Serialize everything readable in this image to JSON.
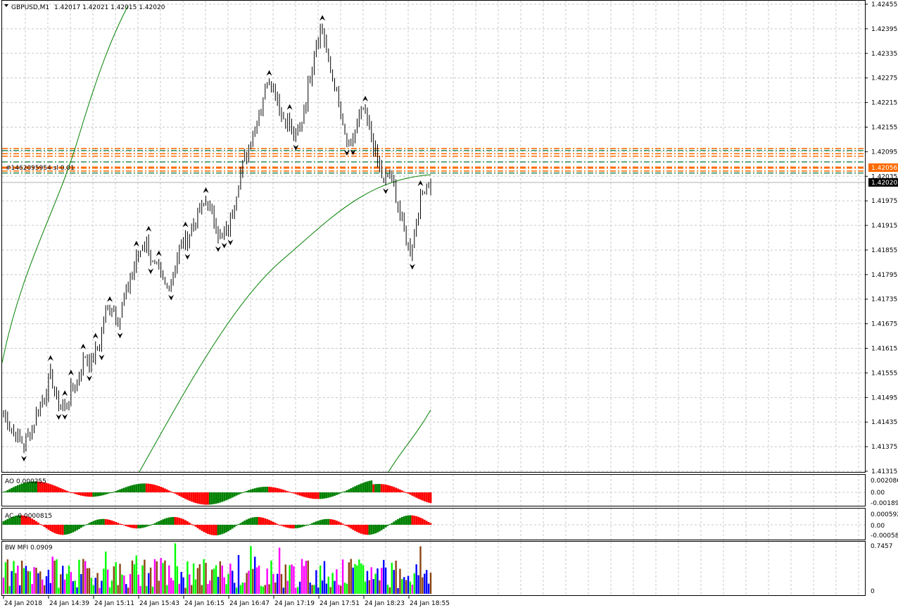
{
  "chart_header": {
    "symbol_tf": "GBPUSD,M1",
    "ohlc": "1.42017 1.42021 1.42015 1.42020",
    "toggle_icon": "triangle-down-icon"
  },
  "colors": {
    "background": "#ffffff",
    "grid": "#c8c8c8",
    "bars": "#000000",
    "ma_line": "#008000",
    "level_orange": "#ff6a00",
    "level_green": "#2e8b57",
    "ao_up": "#008000",
    "ao_down": "#ff0000",
    "mfi_green": "#00ff00",
    "mfi_blue": "#0000ff",
    "mfi_pink": "#ff00ff",
    "mfi_brown": "#8b4513",
    "price_badge_current": "#000000",
    "price_badge_level": "#ff6a00"
  },
  "price_axis": {
    "ticks": [
      "1.42455",
      "1.42395",
      "1.42335",
      "1.42275",
      "1.42215",
      "1.42155",
      "1.42095",
      "1.42035",
      "1.41975",
      "1.41915",
      "1.41855",
      "1.41795",
      "1.41735",
      "1.41675",
      "1.41615",
      "1.41555",
      "1.41495",
      "1.41435",
      "1.41375",
      "1.41315"
    ],
    "current_price": "1.42020",
    "level_price": "1.42056",
    "ylim": [
      1.41315,
      1.42455
    ]
  },
  "level_labels": {
    "main": "#1462095954 sl 0.01"
  },
  "subwindows": {
    "ao": {
      "label": "AO 0.000255",
      "ticks": [
        "0.002086",
        "0.00",
        "-0.001894"
      ]
    },
    "ac": {
      "label": "AC -0.0000815",
      "ticks": [
        "0.000592",
        "0.00",
        "-0.000582"
      ]
    },
    "mfi": {
      "label": "BW MFI 0.0909",
      "ticks": [
        "0.7457",
        "0"
      ]
    }
  },
  "time_axis": {
    "labels": [
      "24 Jan 2018",
      "24 Jan 14:39",
      "24 Jan 15:11",
      "24 Jan 15:43",
      "24 Jan 16:15",
      "24 Jan 16:47",
      "24 Jan 17:19",
      "24 Jan 17:51",
      "24 Jan 18:23",
      "24 Jan 18:55"
    ]
  },
  "chart_data": {
    "type": "candlestick",
    "series": [
      {
        "name": "GBPUSD,M1",
        "values": [
          1.4146,
          1.4142,
          1.414,
          1.4138,
          1.4141,
          1.4146,
          1.415,
          1.4155,
          1.4148,
          1.4147,
          1.4151,
          1.4154,
          1.416,
          1.4158,
          1.4162,
          1.417,
          1.4172,
          1.4168,
          1.4175,
          1.418,
          1.4185,
          1.4188,
          1.4182,
          1.418,
          1.4176,
          1.418,
          1.4186,
          1.4188,
          1.4192,
          1.4195,
          1.4198,
          1.4193,
          1.4188,
          1.419,
          1.4197,
          1.4205,
          1.421,
          1.4215,
          1.4221,
          1.4228,
          1.4225,
          1.4218,
          1.4217,
          1.4212,
          1.4217,
          1.4226,
          1.4236,
          1.424,
          1.423,
          1.4225,
          1.4215,
          1.421,
          1.4215,
          1.422,
          1.4215,
          1.4208,
          1.4202,
          1.4204,
          1.4198,
          1.419,
          1.4185,
          1.4194,
          1.4201,
          1.4202
        ]
      }
    ]
  }
}
